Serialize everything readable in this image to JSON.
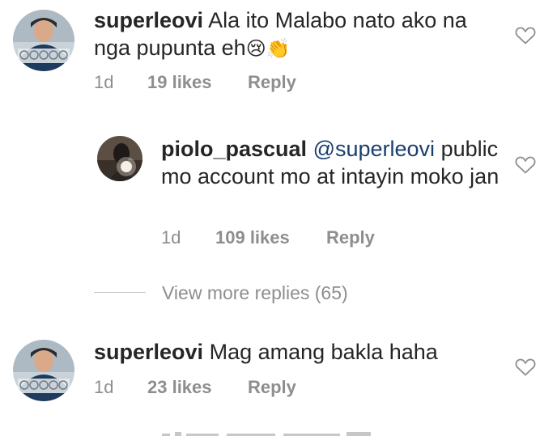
{
  "comments": [
    {
      "username": "superleovi",
      "text": "Ala ito Malabo nato ako na nga pupunta eh",
      "emoji": "😢👏",
      "time": "1d",
      "likes": "19 likes",
      "reply": "Reply"
    },
    {
      "username": "piolo_pascual",
      "mention": "@superleovi",
      "text": "public mo account mo at intayin moko jan",
      "time": "1d",
      "likes": "109 likes",
      "reply": "Reply"
    },
    {
      "username": "superleovi",
      "text": "Mag amang bakla haha",
      "time": "1d",
      "likes": "23 likes",
      "reply": "Reply"
    }
  ],
  "view_more_replies": "View more replies (65)",
  "icons": {
    "like": "heart-outline-icon"
  },
  "colors": {
    "text": "#262626",
    "meta": "#8e8e8e",
    "mention": "#1a3f6e"
  }
}
